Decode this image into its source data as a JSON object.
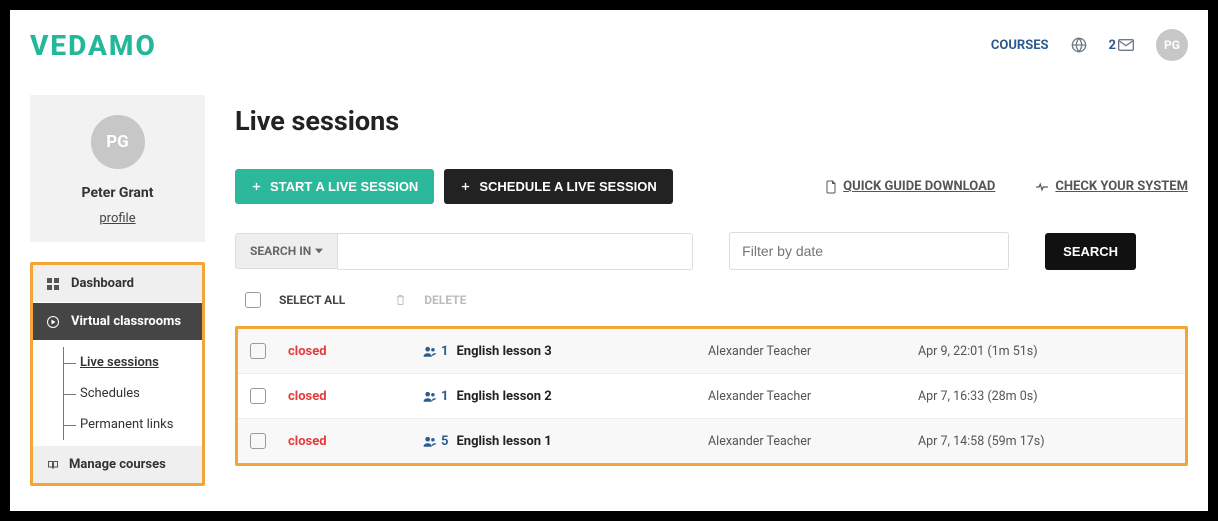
{
  "brand": "VEDAMO",
  "header": {
    "courses_link": "COURSES",
    "message_count": "2",
    "avatar_initials": "PG"
  },
  "sidebar": {
    "avatar_initials": "PG",
    "user_name": "Peter Grant",
    "profile_link": "profile",
    "items": {
      "dashboard": "Dashboard",
      "virtual": "Virtual classrooms",
      "manage": "Manage courses"
    },
    "sub": {
      "live": "Live sessions",
      "schedules": "Schedules",
      "permalinks": "Permanent links"
    }
  },
  "main": {
    "title": "Live sessions",
    "start_btn": "START A LIVE SESSION",
    "schedule_btn": "SCHEDULE A LIVE SESSION",
    "guide_link": "QUICK GUIDE DOWNLOAD",
    "check_link": "CHECK YOUR SYSTEM",
    "search_in": "SEARCH IN",
    "date_placeholder": "Filter by date",
    "search_btn": "SEARCH",
    "select_all": "SELECT ALL",
    "delete": "DELETE"
  },
  "sessions": [
    {
      "status": "closed",
      "participants": "1",
      "title": "English lesson 3",
      "owner": "Alexander Teacher",
      "time": "Apr 9, 22:01 (1m 51s)"
    },
    {
      "status": "closed",
      "participants": "1",
      "title": "English lesson 2",
      "owner": "Alexander Teacher",
      "time": "Apr 7, 16:33 (28m 0s)"
    },
    {
      "status": "closed",
      "participants": "5",
      "title": "English lesson 1",
      "owner": "Alexander Teacher",
      "time": "Apr 7, 14:58 (59m 17s)"
    }
  ]
}
